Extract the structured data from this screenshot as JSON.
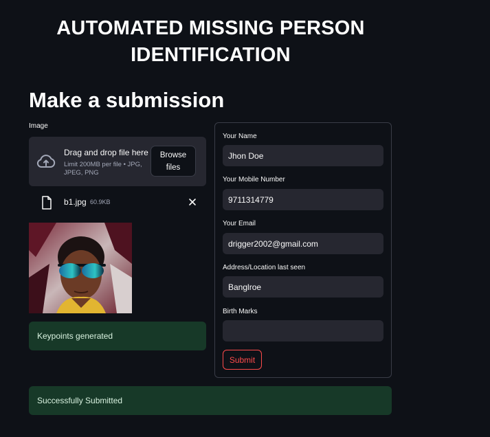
{
  "app": {
    "title": "AUTOMATED MISSING PERSON IDENTIFICATION"
  },
  "page": {
    "title": "Make a submission"
  },
  "uploader": {
    "label": "Image",
    "drop_title": "Drag and drop file here",
    "drop_hint": "Limit 200MB per file • JPG, JPEG, PNG",
    "browse_label": "Browse files",
    "file": {
      "name": "b1.jpg",
      "size": "60.9KB"
    }
  },
  "alerts": {
    "keypoints": "Keypoints generated",
    "success": "Successfully Submitted"
  },
  "form": {
    "name": {
      "label": "Your Name",
      "value": "Jhon Doe"
    },
    "mobile": {
      "label": "Your Mobile Number",
      "value": "9711314779"
    },
    "email": {
      "label": "Your Email",
      "value": "drigger2002@gmail.com"
    },
    "address": {
      "label": "Address/Location last seen",
      "value": "Banglroe"
    },
    "birthmarks": {
      "label": "Birth Marks",
      "value": ""
    },
    "submit_label": "Submit"
  },
  "colors": {
    "background": "#0e1117",
    "input_bg": "#262730",
    "success_bg": "#173928",
    "accent": "#ff4b4b"
  },
  "icons": {
    "upload": "cloud-upload-icon",
    "file": "file-icon",
    "remove": "close-icon"
  }
}
